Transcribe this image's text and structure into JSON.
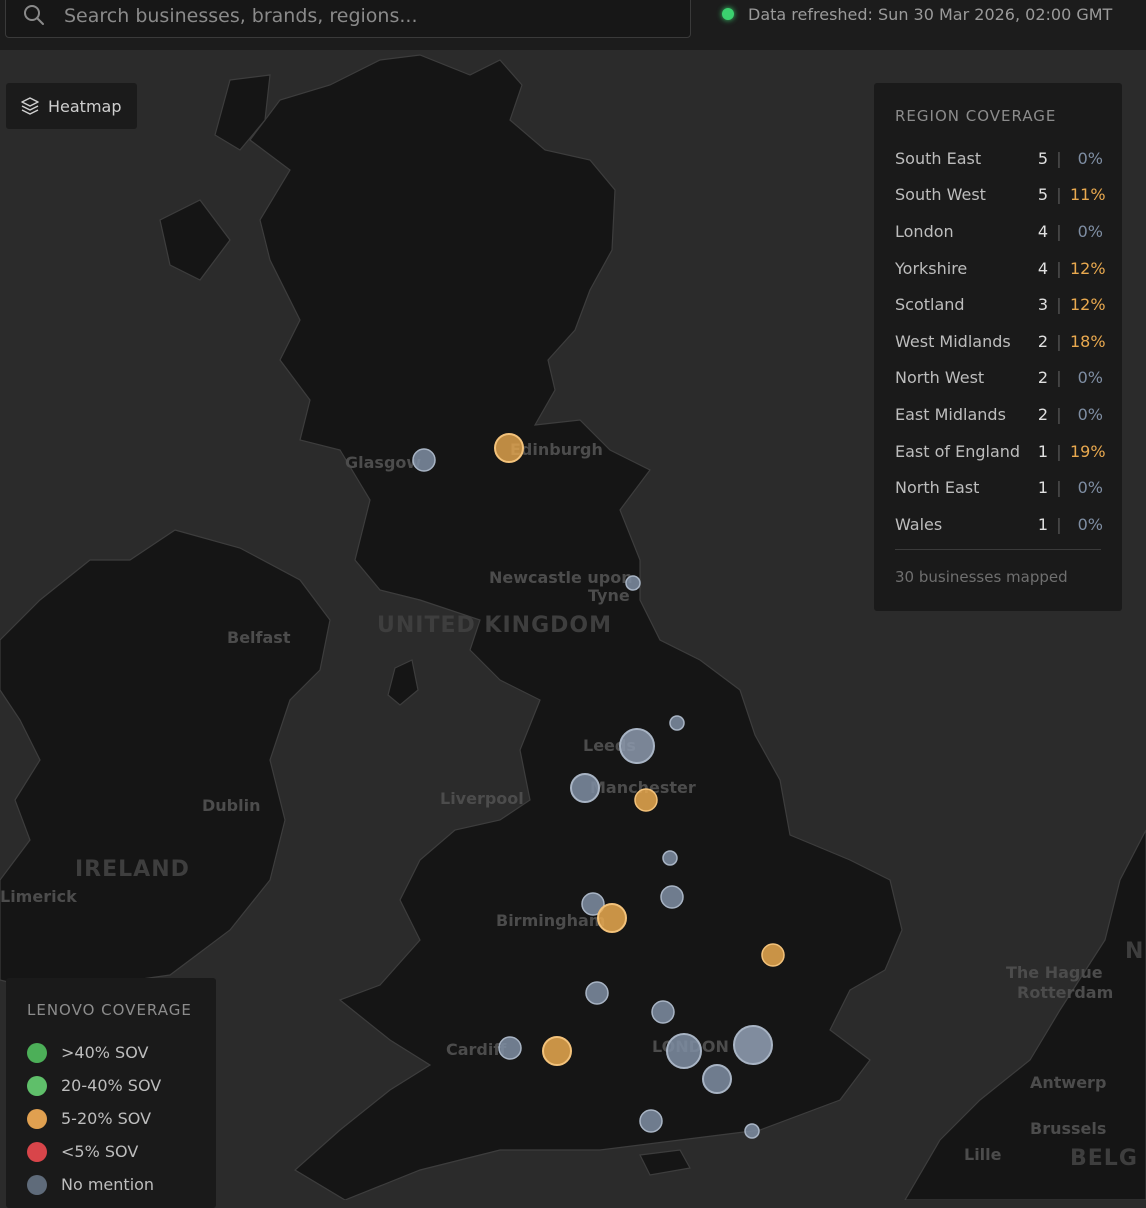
{
  "search": {
    "placeholder": "Search businesses, brands, regions..."
  },
  "status": {
    "refresh_text": "Data refreshed: Sun 30 Mar 2026, 02:00 GMT",
    "indicator_color": "#3bd16f"
  },
  "heatmap_toggle": {
    "label": "Heatmap"
  },
  "map_labels": {
    "country_uk": "UNITED KINGDOM",
    "country_ireland": "IRELAND",
    "country_belgium": "BELG",
    "cities": {
      "glasgow": "Glasgow",
      "edinburgh": "Edinburgh",
      "newcastle_1": "Newcastle upon",
      "newcastle_2": "Tyne",
      "belfast": "Belfast",
      "dublin": "Dublin",
      "limerick": "Limerick",
      "liverpool": "Liverpool",
      "leeds": "Leeds",
      "manchester": "Manchester",
      "birmingham": "Birmingham",
      "cardiff": "Cardiff",
      "london": "LONDON",
      "the_hague": "The Hague",
      "rotterdam": "Rotterdam",
      "antwerp": "Antwerp",
      "brussels": "Brussels",
      "lille": "Lille",
      "nl": "NL"
    }
  },
  "region_coverage": {
    "title": "REGION COVERAGE",
    "regions": [
      {
        "name": "South East",
        "count": "5",
        "pct": "0%",
        "color": "#7f8ea3"
      },
      {
        "name": "South West",
        "count": "5",
        "pct": "11%",
        "color": "#e9a94f"
      },
      {
        "name": "London",
        "count": "4",
        "pct": "0%",
        "color": "#7f8ea3"
      },
      {
        "name": "Yorkshire",
        "count": "4",
        "pct": "12%",
        "color": "#e9a94f"
      },
      {
        "name": "Scotland",
        "count": "3",
        "pct": "12%",
        "color": "#e9a94f"
      },
      {
        "name": "West Midlands",
        "count": "2",
        "pct": "18%",
        "color": "#e9a94f"
      },
      {
        "name": "North West",
        "count": "2",
        "pct": "0%",
        "color": "#7f8ea3"
      },
      {
        "name": "East Midlands",
        "count": "2",
        "pct": "0%",
        "color": "#7f8ea3"
      },
      {
        "name": "East of England",
        "count": "1",
        "pct": "19%",
        "color": "#e9a94f"
      },
      {
        "name": "North East",
        "count": "1",
        "pct": "0%",
        "color": "#7f8ea3"
      },
      {
        "name": "Wales",
        "count": "1",
        "pct": "0%",
        "color": "#7f8ea3"
      }
    ],
    "separator": "|",
    "footer": "30 businesses mapped"
  },
  "legend": {
    "title": "LENOVO COVERAGE",
    "items": [
      {
        "label": ">40% SOV",
        "color": "#4caf58"
      },
      {
        "label": "20-40% SOV",
        "color": "#5fbf6a"
      },
      {
        "label": "5-20% SOV",
        "color": "#e0a050"
      },
      {
        "label": "<5% SOV",
        "color": "#d8454a"
      },
      {
        "label": "No mention",
        "color": "#5f6b7a"
      }
    ]
  }
}
